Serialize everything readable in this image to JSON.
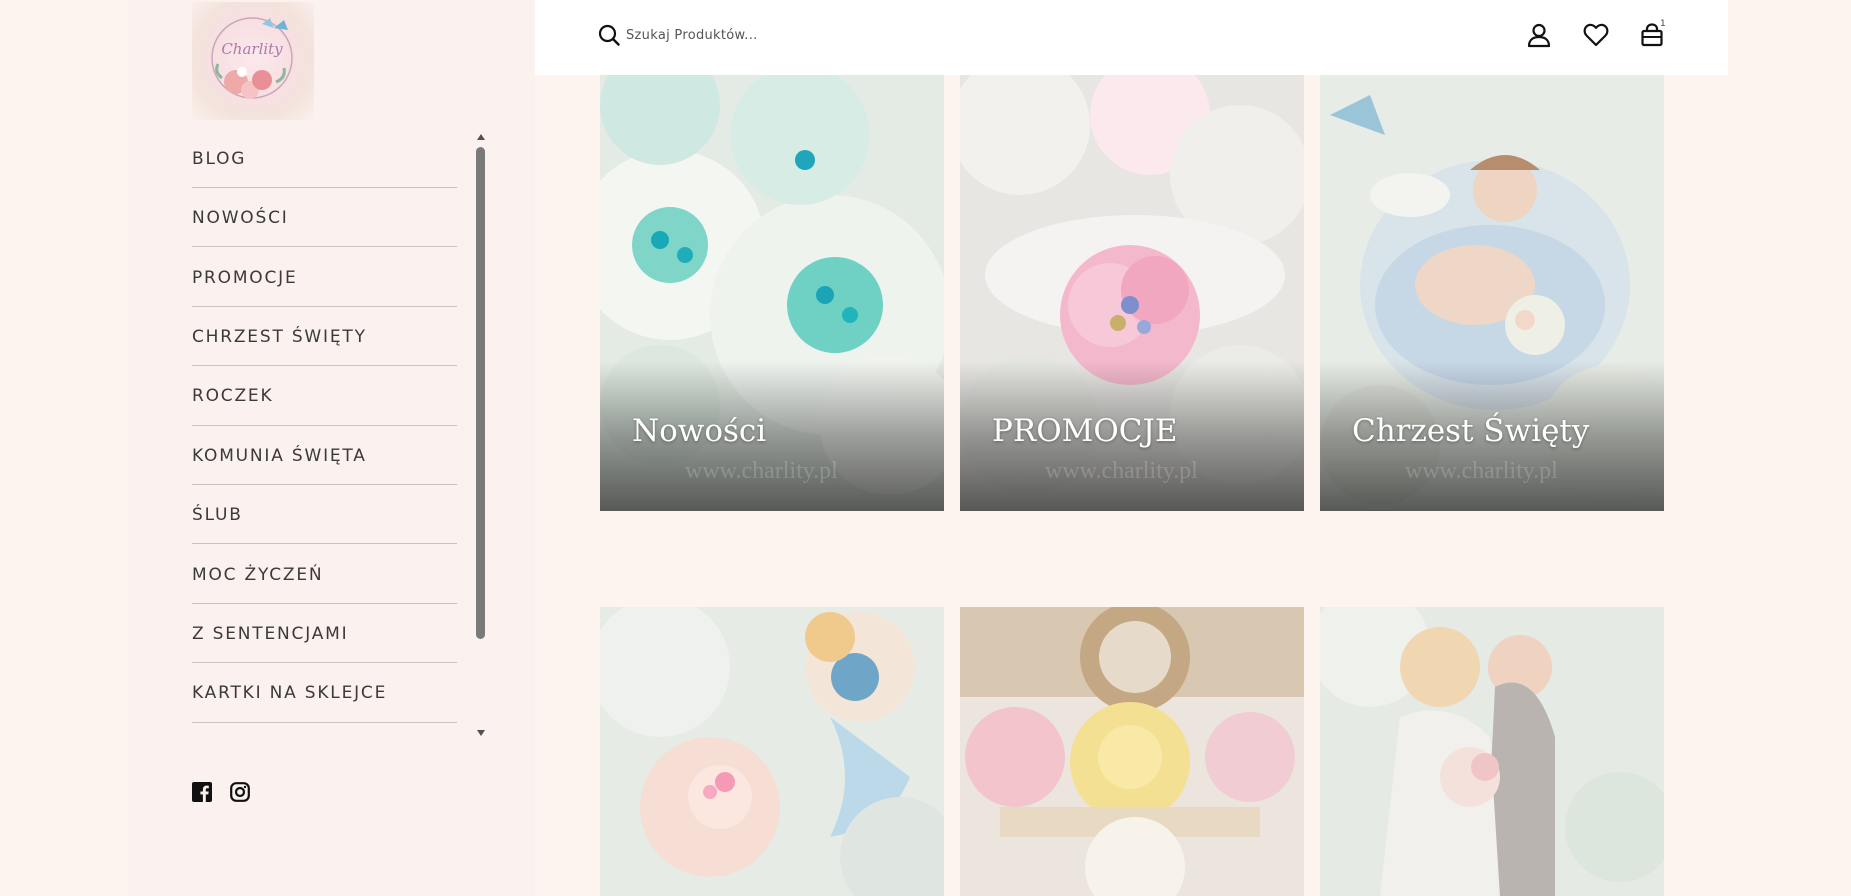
{
  "logo": {
    "text": "Charlity"
  },
  "search": {
    "placeholder": "Szukaj Produktów..."
  },
  "header": {
    "cart_count": "1"
  },
  "nav": {
    "items": [
      {
        "label": "BLOG"
      },
      {
        "label": "NOWOŚCI"
      },
      {
        "label": "PROMOCJE"
      },
      {
        "label": "CHRZEST ŚWIĘTY"
      },
      {
        "label": "ROCZEK"
      },
      {
        "label": "KOMUNIA ŚWIĘTA"
      },
      {
        "label": "ŚLUB"
      },
      {
        "label": "MOC ŻYCZEŃ"
      },
      {
        "label": "Z SENTENCJAMI"
      },
      {
        "label": "KARTKI NA SKLEJCE"
      }
    ]
  },
  "social": [
    "facebook-icon",
    "instagram-icon"
  ],
  "categories": [
    {
      "title": "Nowości",
      "watermark": "www.charlity.pl"
    },
    {
      "title": "PROMOCJE",
      "watermark": "www.charlity.pl"
    },
    {
      "title": "Chrzest Święty",
      "watermark": "www.charlity.pl"
    },
    {
      "title": "",
      "watermark": ""
    },
    {
      "title": "",
      "watermark": ""
    },
    {
      "title": "",
      "watermark": ""
    }
  ]
}
